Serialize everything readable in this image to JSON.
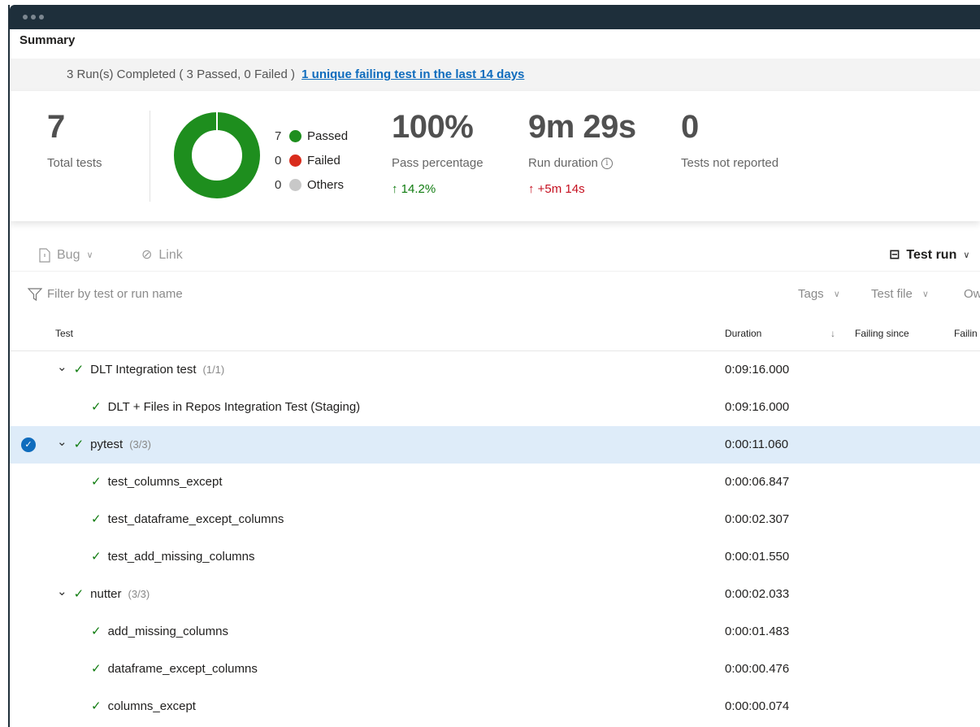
{
  "window": {
    "title": "Summary"
  },
  "banner": {
    "text": "3 Run(s) Completed ( 3 Passed, 0 Failed )",
    "link": "1 unique failing test in the last 14 days"
  },
  "stats": {
    "total_tests": {
      "value": "7",
      "label": "Total tests"
    },
    "donut": {
      "passed": 7,
      "failed": 0,
      "others": 0
    },
    "legend": [
      {
        "count": "7",
        "label": "Passed",
        "color": "#1e8e1e"
      },
      {
        "count": "0",
        "label": "Failed",
        "color": "#d92c1c"
      },
      {
        "count": "0",
        "label": "Others",
        "color": "#c8c8c8"
      }
    ],
    "pass_percentage": {
      "value": "100%",
      "label": "Pass percentage",
      "delta": "14.2%"
    },
    "run_duration": {
      "value": "9m 29s",
      "label": "Run duration",
      "delta": "+5m 14s"
    },
    "not_reported": {
      "value": "0",
      "label": "Tests not reported"
    }
  },
  "toolbar": {
    "bug": "Bug",
    "link": "Link",
    "group_by": "Test run"
  },
  "filter": {
    "placeholder": "Filter by test or run name",
    "tags": "Tags",
    "test_file": "Test file",
    "owner": "Ow"
  },
  "table": {
    "headers": {
      "test": "Test",
      "duration": "Duration",
      "failing_since": "Failing since",
      "failing": "Failin"
    },
    "rows": [
      {
        "name": "DLT Integration test",
        "count": "(1/1)",
        "duration": "0:09:16.000",
        "level": 0,
        "group": true,
        "selected": false
      },
      {
        "name": "DLT + Files in Repos Integration Test (Staging)",
        "count": "",
        "duration": "0:09:16.000",
        "level": 1,
        "group": false,
        "selected": false
      },
      {
        "name": "pytest",
        "count": "(3/3)",
        "duration": "0:00:11.060",
        "level": 0,
        "group": true,
        "selected": true
      },
      {
        "name": "test_columns_except",
        "count": "",
        "duration": "0:00:06.847",
        "level": 1,
        "group": false,
        "selected": false
      },
      {
        "name": "test_dataframe_except_columns",
        "count": "",
        "duration": "0:00:02.307",
        "level": 1,
        "group": false,
        "selected": false
      },
      {
        "name": "test_add_missing_columns",
        "count": "",
        "duration": "0:00:01.550",
        "level": 1,
        "group": false,
        "selected": false
      },
      {
        "name": "nutter",
        "count": "(3/3)",
        "duration": "0:00:02.033",
        "level": 0,
        "group": true,
        "selected": false
      },
      {
        "name": "add_missing_columns",
        "count": "",
        "duration": "0:00:01.483",
        "level": 1,
        "group": false,
        "selected": false
      },
      {
        "name": "dataframe_except_columns",
        "count": "",
        "duration": "0:00:00.476",
        "level": 1,
        "group": false,
        "selected": false
      },
      {
        "name": "columns_except",
        "count": "",
        "duration": "0:00:00.074",
        "level": 1,
        "group": false,
        "selected": false
      }
    ]
  }
}
